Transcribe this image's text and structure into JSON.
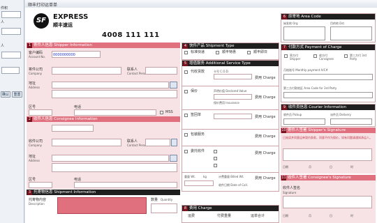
{
  "left_panel": {
    "labels": [
      "件积",
      "人",
      "人"
    ],
    "confirm_label": "确认",
    "reset_label": "重置"
  },
  "window": {
    "title": "顺丰打印运单单"
  },
  "logo": {
    "mark": "SF",
    "brand": "EXPRESS",
    "brand_cn": "顺丰速运",
    "hotline": "4008 111 111"
  },
  "shipper": {
    "header": "寄件人信息 Shipper Information",
    "num": "1",
    "account_label": "客户编码",
    "account_sub": "Account No.",
    "account_value": "0000000000",
    "company_label": "寄件公司",
    "company_sub": "Company",
    "contact_label": "联系人",
    "contact_sub": "Contact Person",
    "address_label": "地址",
    "address_sub": "Address",
    "zip_label": "区号",
    "phone_label": "电话",
    "mss_label": "MSS"
  },
  "consignee": {
    "header": "收件人信息 Consignee Information",
    "num": "2",
    "company_label": "收件公司",
    "company_sub": "Company",
    "contact_label": "联系人",
    "contact_sub": "Contact Person",
    "address_label": "地址",
    "address_sub": "Address",
    "zip_label": "区号",
    "phone_label": "电话"
  },
  "shipment": {
    "header": "托寄物信息 Shipment Information",
    "num": "3",
    "content_label": "托寄物内容",
    "content_sub": "Description",
    "qty_label": "数量",
    "qty_sub": "Quantity"
  },
  "service": {
    "header": "快件产品 Shipment Type",
    "num": "4",
    "options": [
      "标准快递",
      "顺丰特惠",
      "顺丰即日"
    ]
  },
  "additional": {
    "header": "增值服务 Additional Service Type",
    "num": "5",
    "rows": [
      "代收货款",
      "保价",
      "签回单",
      "包装服务",
      "委托收件",
      "其他"
    ],
    "charge_label": "费用 Charge",
    "notes": [
      "卡号 C.O.D.",
      "声明价值 Declared Value",
      "保价费用 Insurance"
    ]
  },
  "weight": {
    "label": "重量 Wt.",
    "unit": "kg",
    "vol_label": "计费重量 Billed Wt.",
    "date_label": "收件日期 Date of Coll."
  },
  "charge": {
    "header": "费用 Charge",
    "num": "8",
    "cols": [
      "运费",
      "付费重量",
      "运单合计"
    ]
  },
  "area_code": {
    "header": "原寄地 Area Code",
    "num": "6",
    "from_label": "始发地 Org",
    "to_label": "目的地 Dst"
  },
  "payment": {
    "header": "付款方式 Payment of Charge",
    "num": "7",
    "options": [
      "寄方付 Shipper",
      "收方付 Consignee",
      "第三方付 3rd Party"
    ],
    "monthly_label": "月结账号 Monthly payment A/C#",
    "area_label": "第三方付款地区 Area Code for 3rd Party"
  },
  "courier": {
    "header": "收件员信息 Courier Information",
    "num": "9",
    "pickup_label": "收件员 Pickup",
    "deliver_label": "派件员 Delivery"
  },
  "shipper_sign": {
    "header": "寄件人签署 Shipper's Signature",
    "num": "10",
    "terms": "已阅读并同意运单契约条款，同意不作为保价，如有问题请通知承运人。",
    "date_label": "日期",
    "month_label": "月",
    "day_label": "日",
    "time_label": "时"
  },
  "consignee_sign": {
    "header": "收件人签署 Consignee's Signature",
    "num": "11",
    "sign_label": "收件人签名",
    "sign_sub": "Signature",
    "date_label": "日期",
    "month_label": "月",
    "day_label": "日",
    "time_label": "时"
  },
  "colors": {
    "accent": "#e0707e",
    "dark_accent": "#7a1220",
    "pink_fill": "#f7e3e6",
    "brand": "#111111"
  }
}
